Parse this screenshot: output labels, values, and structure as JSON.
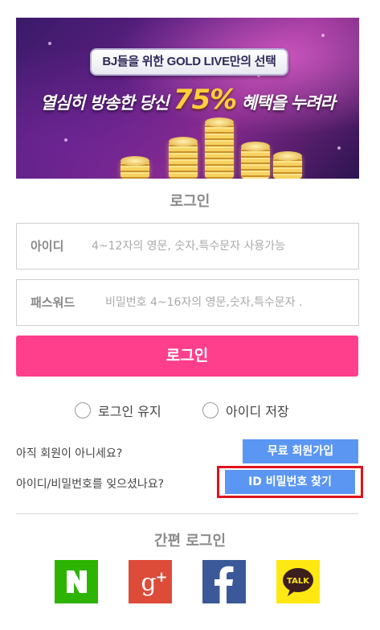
{
  "banner": {
    "badge_text": "BJ들을 위한 GOLD LIVE만의 선택",
    "headline_pre": "열심히 방송한 당신 ",
    "headline_highlight": "75%",
    "headline_post": " 혜택을 누려라"
  },
  "login": {
    "title": "로그인",
    "id_label": "아이디",
    "id_placeholder": "4~12자의 영문, 숫자,특수문자 사용가능",
    "pw_label": "패스워드",
    "pw_placeholder": "비밀번호 4~16자의 영문,숫자,특수문자 .",
    "submit_label": "로그인",
    "keep_login_label": "로그인 유지",
    "save_id_label": "아이디 저장"
  },
  "links": {
    "not_member_text": "아직 회원이 아니세요?",
    "signup_label": "무료 회원가입",
    "forgot_text": "아이디/비밀번호를 잊으셨나요?",
    "find_label": "ID 비밀번호 찾기"
  },
  "easy_login": {
    "title": "간편 로그인",
    "providers": [
      {
        "name": "naver",
        "glyph": "N",
        "color": "#2db400"
      },
      {
        "name": "google-plus",
        "glyph": "g+",
        "color": "#dd4b39"
      },
      {
        "name": "facebook",
        "glyph": "f",
        "color": "#3b5998"
      },
      {
        "name": "kakaotalk",
        "glyph": "TALK",
        "color": "#ffe812"
      }
    ]
  },
  "colors": {
    "primary_pink": "#ff3e8c",
    "button_blue": "#5b96f2",
    "highlight_red": "#e0121b"
  }
}
